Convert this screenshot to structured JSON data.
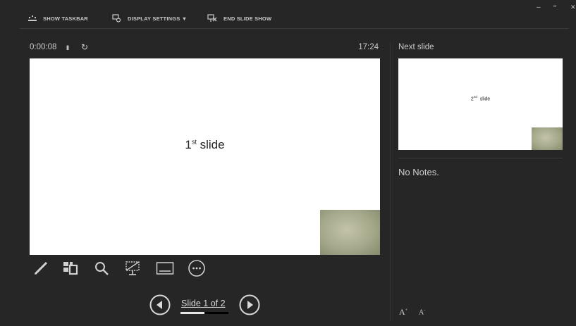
{
  "toolbar": {
    "show_taskbar": "SHOW TASKBAR",
    "display_settings": "DISPLAY SETTINGS ▼",
    "end_slide_show": "END SLIDE SHOW"
  },
  "window_controls": {
    "minimize": "–",
    "restore": "▫",
    "close": "✕"
  },
  "presenter": {
    "elapsed": "0:00:08",
    "pause": "II",
    "reset": "↻",
    "clock": "17:24"
  },
  "current_slide": {
    "text_main": "1",
    "text_sup": "st",
    "text_rest": " slide"
  },
  "navigation": {
    "slide_counter": "Slide 1 of 2",
    "progress": 0.5
  },
  "next_slide": {
    "label": "Next slide",
    "text_main": "2",
    "text_sup": "nd",
    "text_rest": "  slide"
  },
  "notes": {
    "text": "No Notes."
  },
  "font_controls": {
    "increase": "A",
    "decrease": "A"
  },
  "icons": [
    "taskbar-icon",
    "display-settings-icon",
    "end-show-icon",
    "pen-icon",
    "all-slides-icon",
    "zoom-icon",
    "black-screen-icon",
    "subtitles-icon",
    "more-options-icon",
    "previous-icon",
    "next-icon"
  ],
  "colors": {
    "background": "#262626",
    "text": "#d8d8d8",
    "slide": "#ffffff"
  }
}
